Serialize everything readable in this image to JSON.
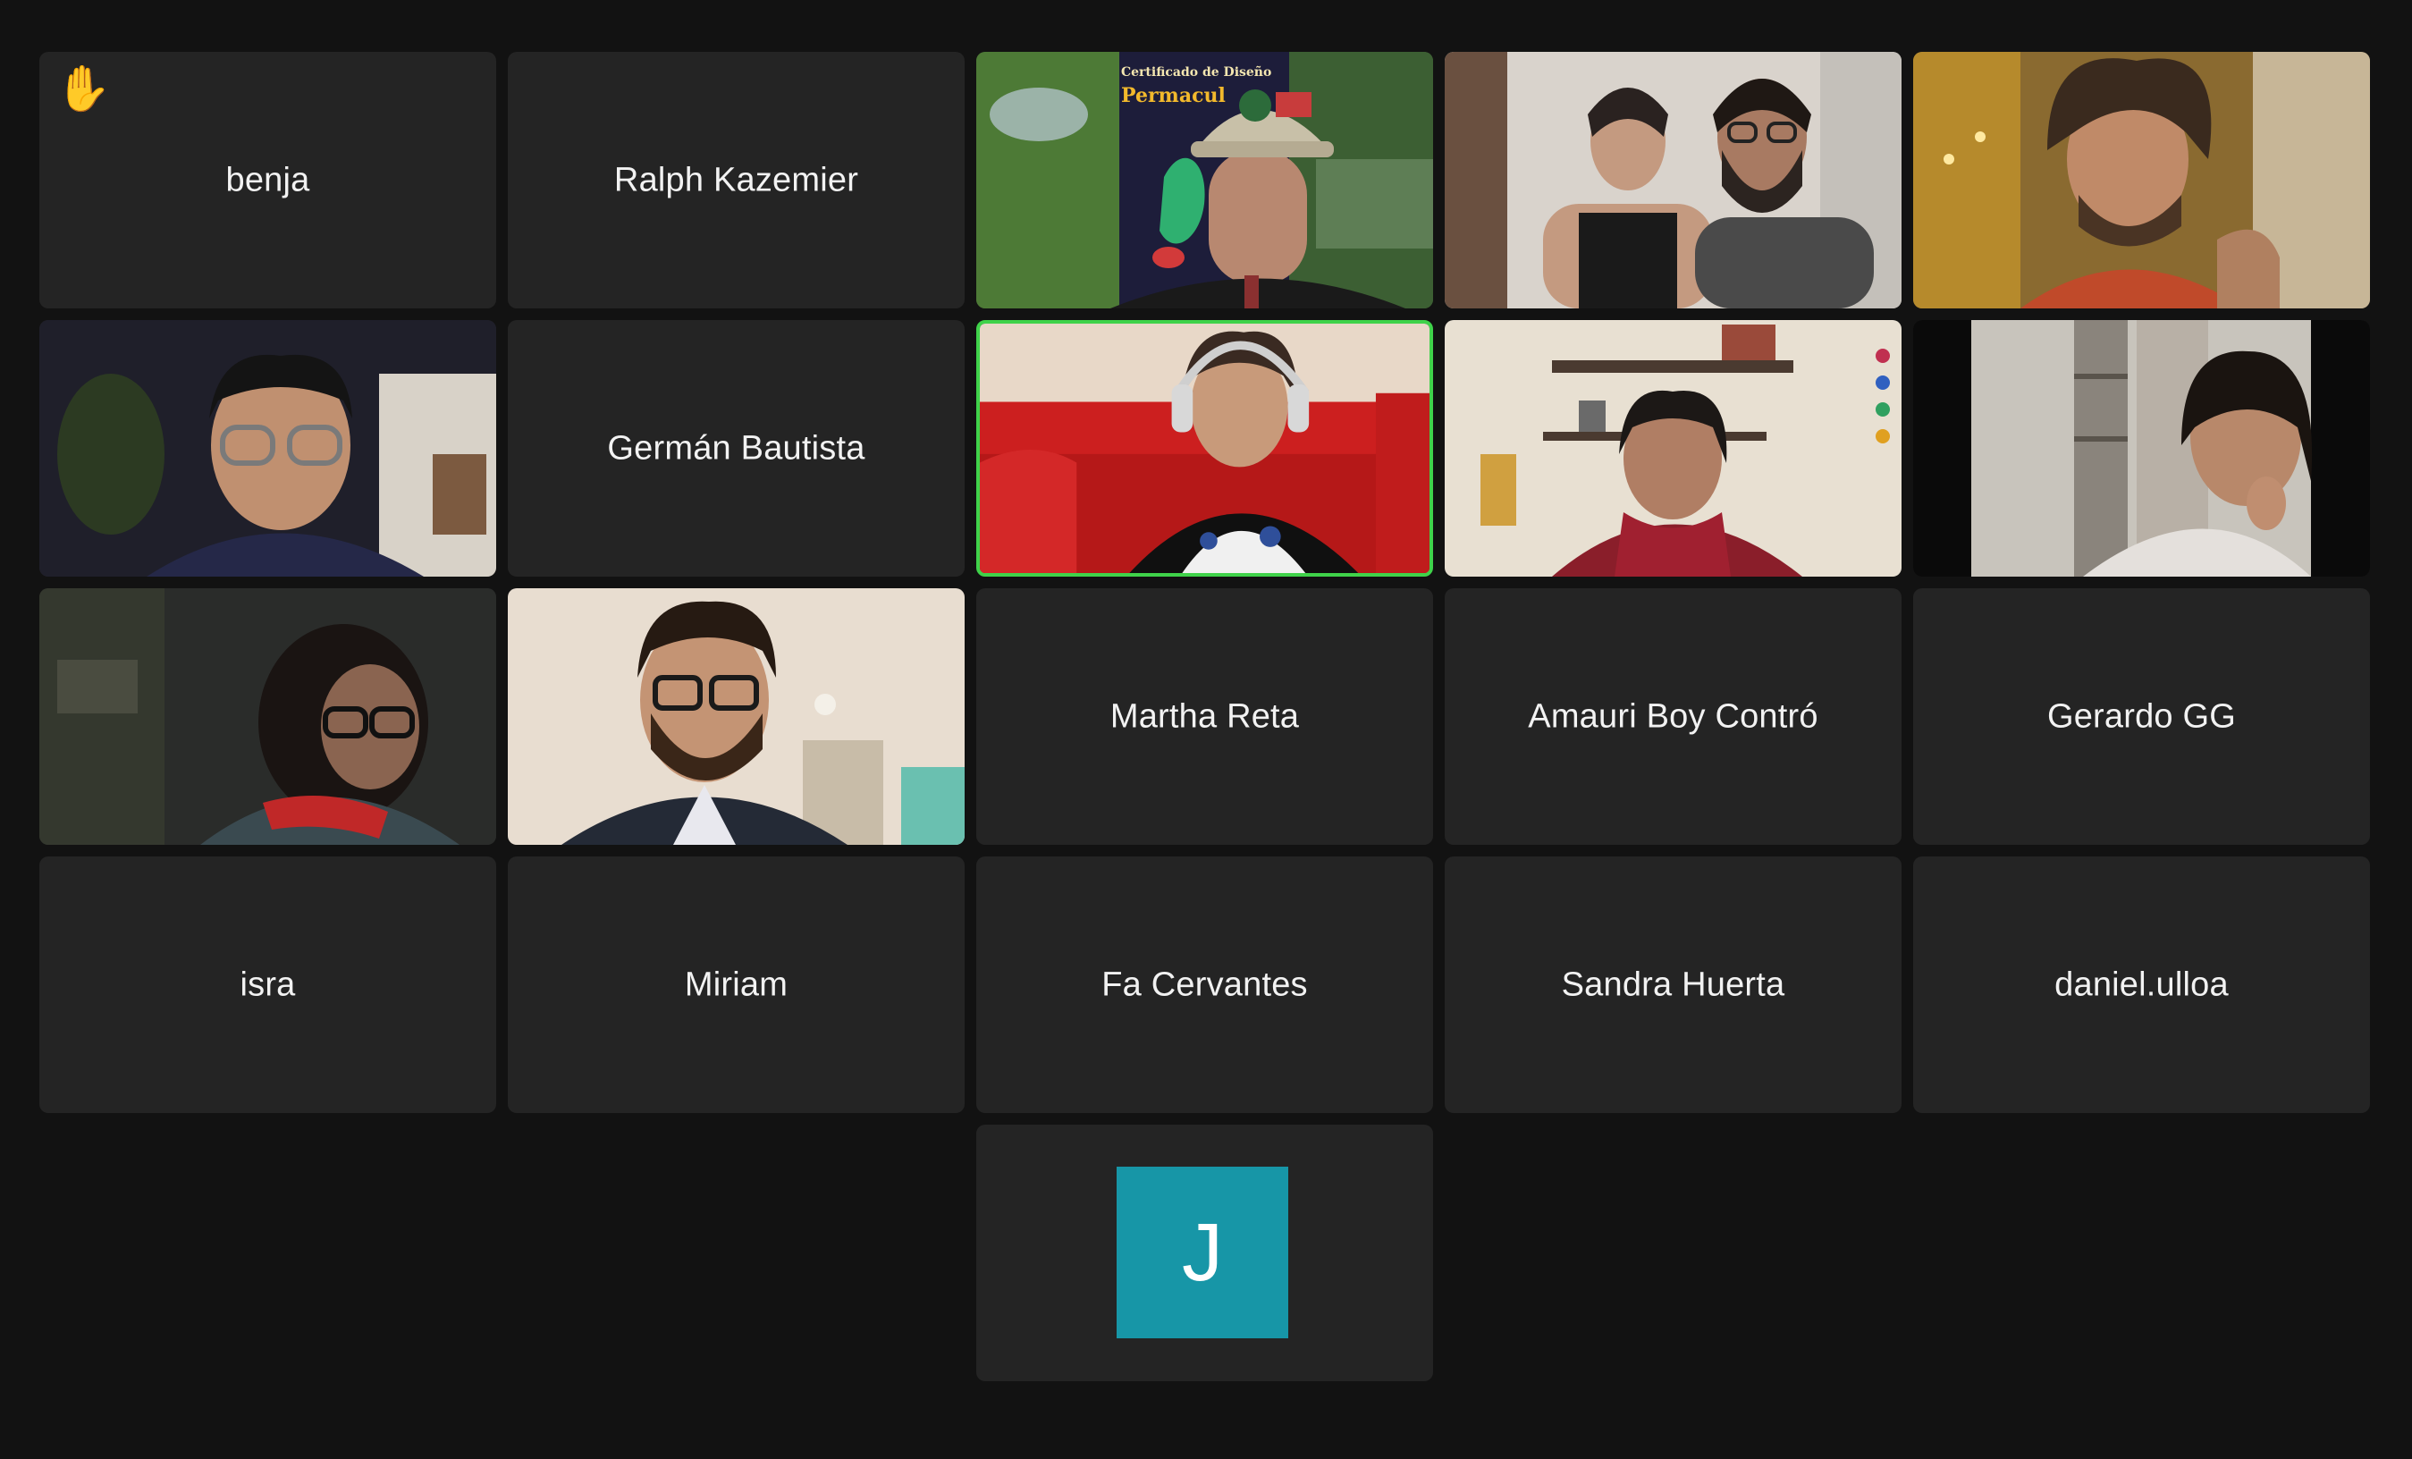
{
  "participants": [
    {
      "name": "benja",
      "video": false,
      "raised_hand": true,
      "raise_hand_icon": "✋"
    },
    {
      "name": "Ralph Kazemier",
      "video": false
    },
    {
      "name": "",
      "video": true,
      "scene": "cap-man"
    },
    {
      "name": "",
      "video": true,
      "scene": "couple"
    },
    {
      "name": "",
      "video": true,
      "scene": "curly-man"
    },
    {
      "name": "",
      "video": true,
      "scene": "glasses-man"
    },
    {
      "name": "Germán Bautista",
      "video": false
    },
    {
      "name": "",
      "video": true,
      "scene": "headphones-woman",
      "active_speaker": true
    },
    {
      "name": "",
      "video": true,
      "scene": "scarf-woman"
    },
    {
      "name": "",
      "video": true,
      "scene": "young-woman"
    },
    {
      "name": "",
      "video": true,
      "scene": "dark-woman"
    },
    {
      "name": "",
      "video": true,
      "scene": "beard-man"
    },
    {
      "name": "Martha Reta",
      "video": false
    },
    {
      "name": "Amauri Boy Contró",
      "video": false
    },
    {
      "name": "Gerardo GG",
      "video": false
    },
    {
      "name": "isra",
      "video": false
    },
    {
      "name": "Miriam",
      "video": false
    },
    {
      "name": "Fa Cervantes",
      "video": false
    },
    {
      "name": "Sandra Huerta",
      "video": false
    },
    {
      "name": "daniel.ulloa",
      "video": false
    },
    {
      "name": "",
      "video": false,
      "avatar_initial": "J",
      "avatar_color": "#1796a7"
    }
  ],
  "background_scenes": {
    "cap-man": {
      "sign_line1": "Certificado de Diseño",
      "sign_line2": "Permacul"
    }
  },
  "colors": {
    "background": "#121212",
    "tile": "#242424",
    "active_speaker_border": "#3fd24a",
    "avatar": "#1796a7"
  }
}
